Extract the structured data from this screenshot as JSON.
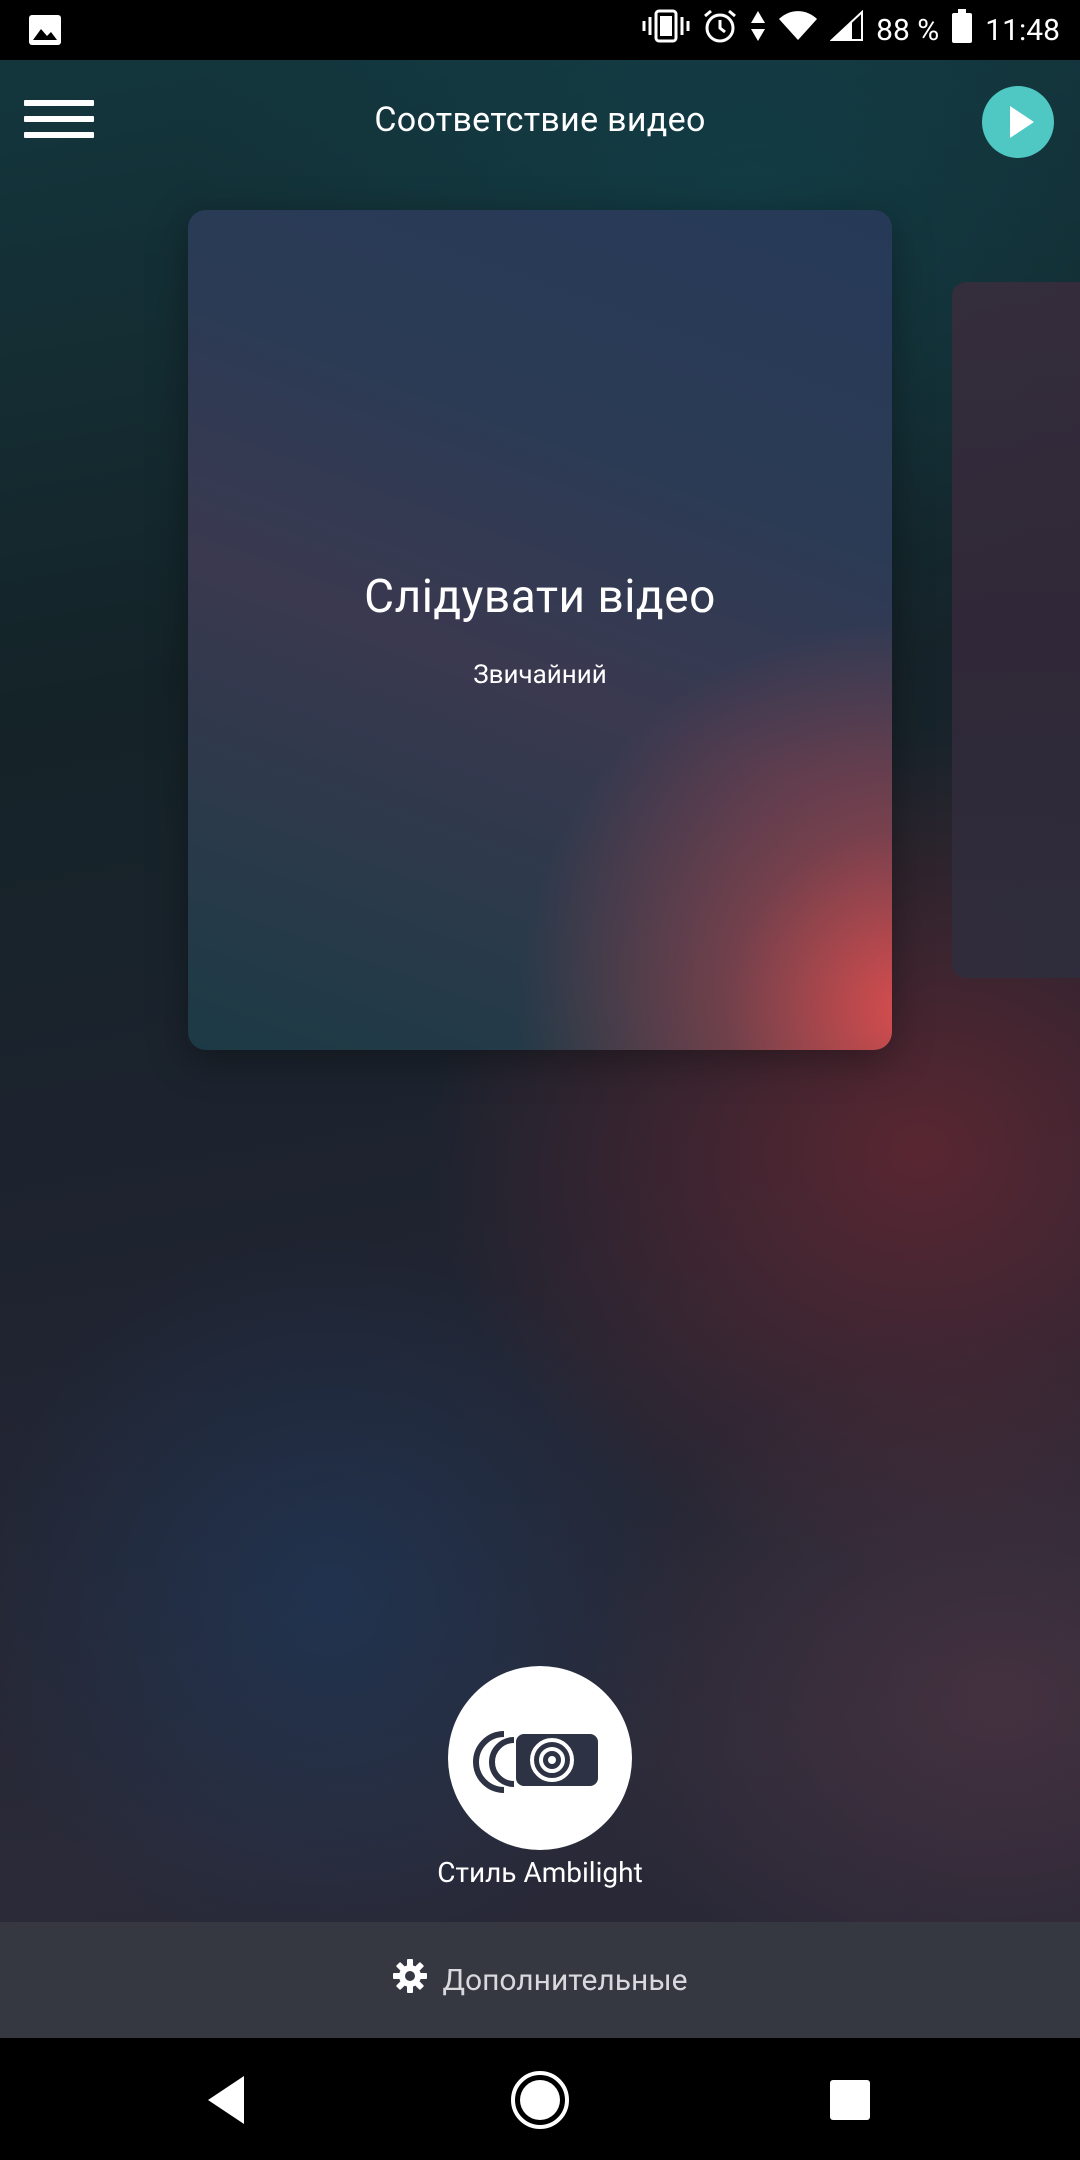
{
  "status_bar": {
    "battery": "88 %",
    "time": "11:48",
    "icons": [
      "image-icon",
      "vibrate-icon",
      "alarm-icon",
      "data-arrows-icon",
      "wifi-icon",
      "signal-icon",
      "battery-icon"
    ]
  },
  "header": {
    "title": "Соответствие видео",
    "menu_icon": "hamburger-menu-icon",
    "play_icon": "play-icon"
  },
  "cards": [
    {
      "title": "Слідувати відео",
      "subtitle": "Звичайний"
    }
  ],
  "style_button": {
    "label": "Стиль Ambilight",
    "icon": "projector-icon"
  },
  "advanced": {
    "label": "Дополнительные",
    "icon": "gear-icon"
  },
  "nav_bar": {
    "icons": [
      "back-icon",
      "home-icon",
      "recents-icon"
    ]
  },
  "colors": {
    "accent": "#4fc7c2",
    "bottom_bar": "#353840",
    "card_highlight": "#e24e4e"
  }
}
